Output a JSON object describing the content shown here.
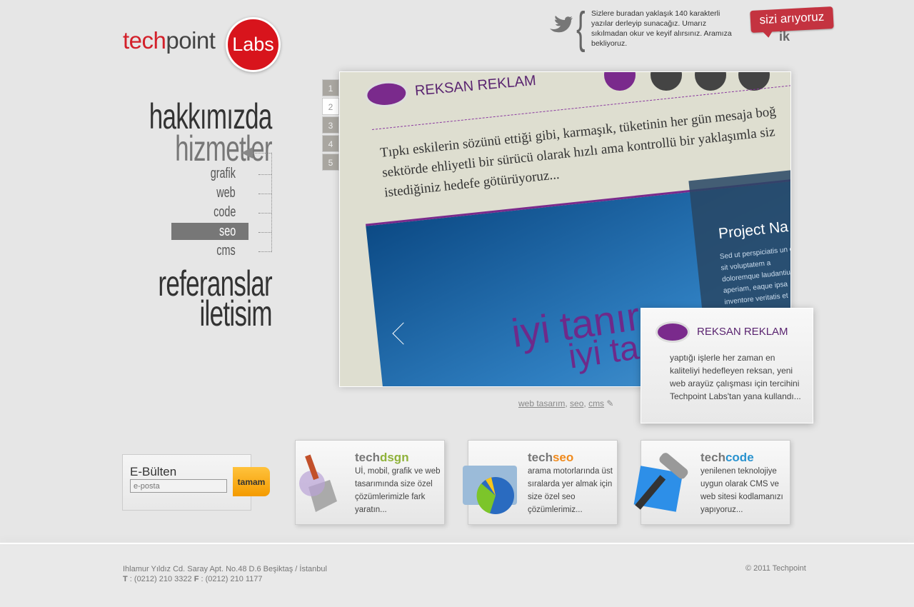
{
  "brand": {
    "tech": "tech",
    "point": "point",
    "labs": "Labs",
    "accent": "#d8141c"
  },
  "twitter": {
    "icon": "twitter-bird-icon",
    "text": "Sizlere buradan yaklaşık 140 karakterli yazılar derleyip sunacağız. Umarız sıkılmadan okur ve keyif alırsınız. Aramıza bekliyoruz."
  },
  "jobs": {
    "label": "sizi arıyoruz",
    "sub": "ik"
  },
  "nav": {
    "about": "hakkımızda",
    "services": "hizmetler",
    "sub": [
      "grafik",
      "web",
      "code",
      "seo",
      "cms"
    ],
    "active_sub": "seo",
    "refs": "referanslar",
    "contact": "iletisim"
  },
  "slider": {
    "pages": [
      "1",
      "2",
      "3",
      "4",
      "5"
    ],
    "active": "2",
    "slide": {
      "brand": "REKSAN REKLAM",
      "quote": "Tıpkı eskilerin sözünü ettiği gibi, karmaşık, tüketinin her gün mesaja boğ sektörde ehliyetli bir sürücü olarak hızlı ama kontrollü bir yaklaşımla siz istediğiniz hedefe götürüyoruz...",
      "tag1": "iyi tanır,",
      "tag2": "iyi ta",
      "project": "Project Na",
      "project_text": "Sed ut perspiciatis un error sit voluptatem a doloremque laudantiu aperiam, eaque ipsa inventore veritatis et"
    },
    "info": {
      "brand": "REKSAN REKLAM",
      "text": "yaptığı işlerle her zaman en kaliteliyi hedefleyen reksan, yeni web arayüz çalışması için tercihini Techpoint Labs'tan yana kullandı..."
    },
    "tags": [
      "web tasarım",
      "seo",
      "cms"
    ],
    "sep": ", "
  },
  "newsletter": {
    "title": "E-Bülten",
    "placeholder": "e-posta",
    "button": "tamam"
  },
  "cards": [
    {
      "a": "tech",
      "b": "dsgn",
      "color": "#8fb23a",
      "text": "Uİ, mobil, grafik ve web tasarımında size özel çözümlerimizle fark yaratın..."
    },
    {
      "a": "tech",
      "b": "seo",
      "color": "#f08a1c",
      "text": "arama motorlarında üst sıralarda yer almak için size özel seo çözümlerimiz..."
    },
    {
      "a": "tech",
      "b": "code",
      "color": "#2a93cf",
      "text": "yenilenen teknolojiye uygun olarak CMS ve web sitesi kodlamanızı yapıyoruz..."
    }
  ],
  "footer": {
    "address": "Ihlamur Yıldız Cd. Saray Apt. No.48 D.6 Beşiktaş / İstanbul",
    "t_label": "T",
    "phone": " : (0212) 210 3322 ",
    "f_label": "F",
    "fax": " : (0212) 210 1177",
    "copyright": "© 2011 Techpoint"
  }
}
